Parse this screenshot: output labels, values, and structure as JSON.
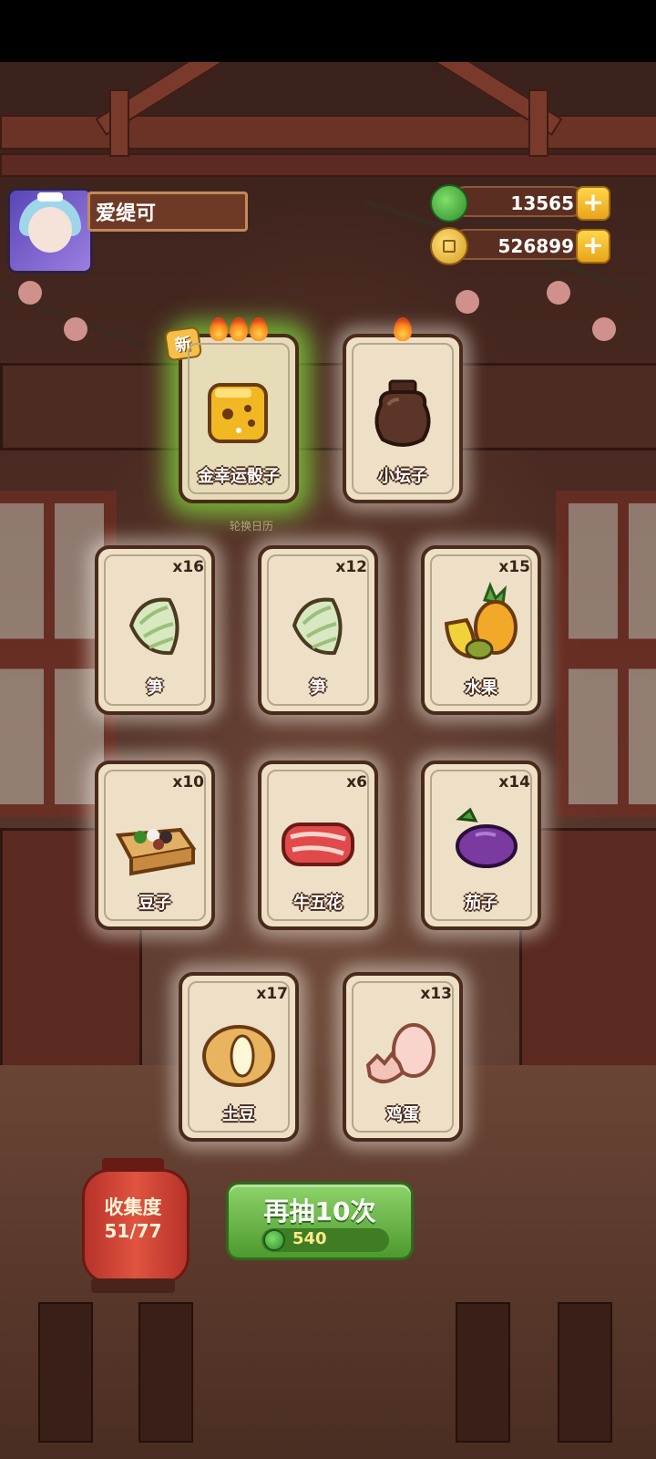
{
  "player": {
    "name": "爱缇可"
  },
  "currencies": [
    {
      "id": "jade",
      "icon": "jade-token-icon",
      "value": "13565",
      "color": "#3fa83a"
    },
    {
      "id": "coin",
      "icon": "gold-coin-icon",
      "value": "526899",
      "color": "#e0a82a"
    }
  ],
  "cards": [
    {
      "label": "金幸运骰子",
      "count": "",
      "is_new": true,
      "new_label": "新",
      "flames": 3,
      "art": "golden-lucky-dice"
    },
    {
      "label": "小坛子",
      "count": "",
      "is_new": false,
      "flames": 1,
      "art": "small-clay-jar"
    },
    {
      "label": "笋",
      "count": "x16",
      "art": "bamboo-shoot"
    },
    {
      "label": "笋",
      "count": "x12",
      "art": "bamboo-shoot"
    },
    {
      "label": "水果",
      "count": "x15",
      "art": "fruit"
    },
    {
      "label": "豆子",
      "count": "x10",
      "art": "beans"
    },
    {
      "label": "牛五花",
      "count": "x6",
      "art": "beef-belly"
    },
    {
      "label": "茄子",
      "count": "x14",
      "art": "eggplant"
    },
    {
      "label": "土豆",
      "count": "x17",
      "art": "potato"
    },
    {
      "label": "鸡蛋",
      "count": "x13",
      "art": "egg"
    }
  ],
  "background_caption": "轮换日历",
  "collection": {
    "title": "收集度",
    "value": "51/77"
  },
  "draw_button": {
    "label": "再抽10次",
    "cost": "540",
    "cost_icon": "jade-token-icon"
  }
}
